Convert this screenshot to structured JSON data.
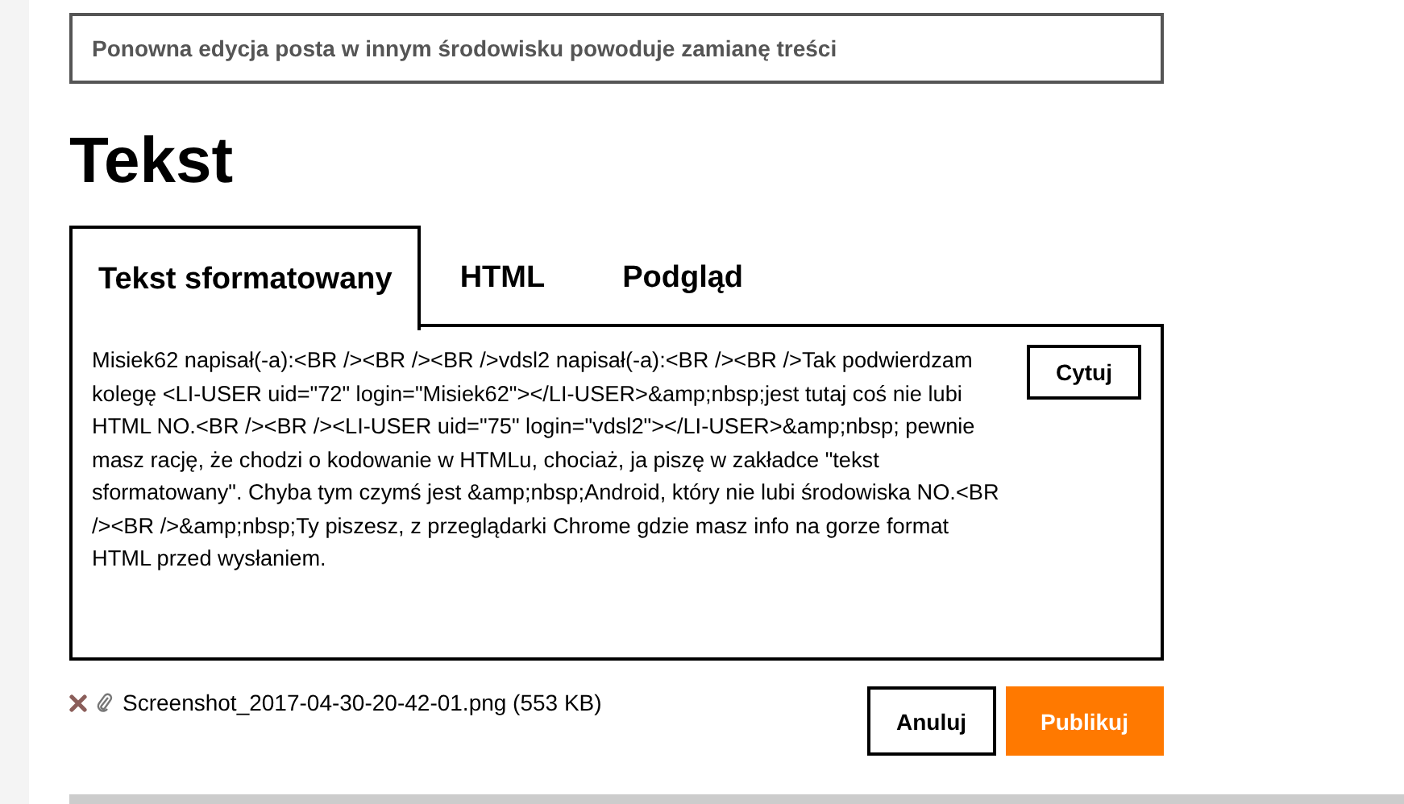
{
  "subject": {
    "value": "Ponowna edycja posta w innym środowisku powoduje zamianę treści"
  },
  "heading": "Tekst",
  "tabs": [
    {
      "label": "Tekst sformatowany",
      "selected": true
    },
    {
      "label": "HTML",
      "selected": false
    },
    {
      "label": "Podgląd",
      "selected": false
    }
  ],
  "editor": {
    "body": "Misiek62 napisał(-a):<BR /><BR /><BR />vdsl2 napisał(-a):<BR /><BR />Tak podwierdzam kolegę <LI-USER uid=\"72\" login=\"Misiek62\"></LI-USER>&amp;nbsp;jest tutaj coś nie lubi HTML NO.<BR /><BR /><LI-USER uid=\"75\" login=\"vdsl2\"></LI-USER>&amp;nbsp; pewnie masz rację, że chodzi o kodowanie w HTMLu, chociaż, ja piszę w zakładce \"tekst sformatowany\". Chyba tym czymś jest &amp;nbsp;Android, który nie lubi środowiska NO.<BR /><BR />&amp;nbsp;Ty piszesz, z przeglądarki Chrome gdzie masz info na gorze format HTML przed wysłaniem.",
    "quote_button": "Cytuj"
  },
  "attachment": {
    "filename": "Screenshot_2017-04-30-20-42-01.png (553 KB)"
  },
  "buttons": [
    {
      "label": "Anuluj",
      "kind": "secondary"
    },
    {
      "label": "Publikuj",
      "kind": "primary"
    }
  ]
}
